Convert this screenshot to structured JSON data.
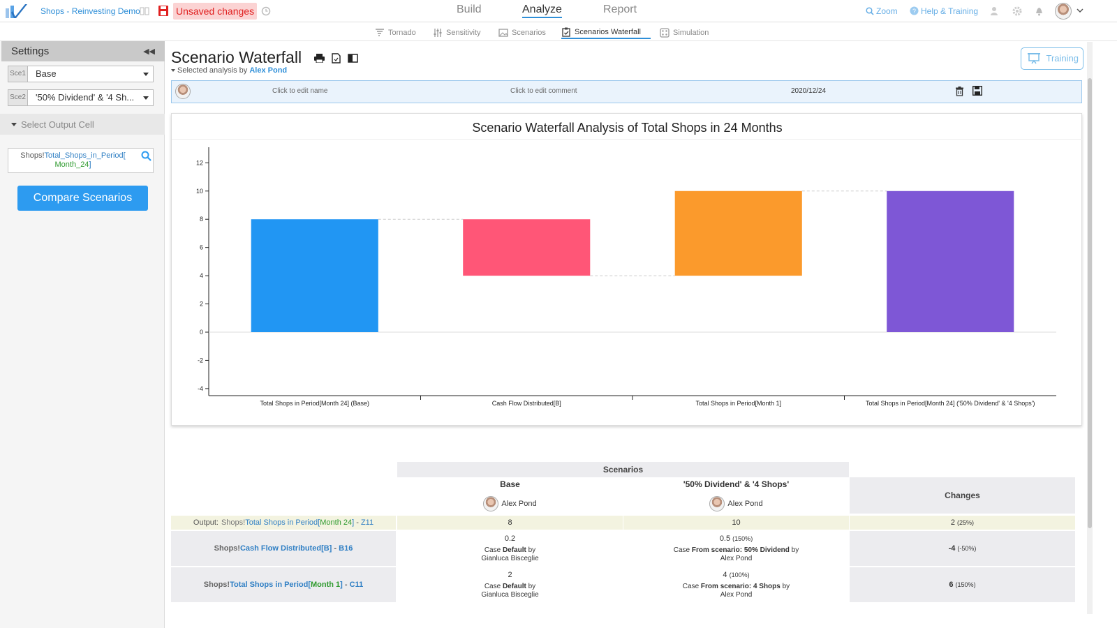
{
  "app": {
    "doc_title": "Shops - Reinvesting Demo",
    "unsaved": "Unsaved changes"
  },
  "topnav": {
    "build": "Build",
    "analyze": "Analyze",
    "report": "Report",
    "zoom": "Zoom",
    "help": "Help & Training"
  },
  "subnav": [
    {
      "label": "Tornado",
      "icon": "tornado-icon"
    },
    {
      "label": "Sensitivity",
      "icon": "sliders-icon"
    },
    {
      "label": "Scenarios",
      "icon": "image-icon"
    },
    {
      "label": "Scenarios Waterfall",
      "icon": "clipboard-check-icon",
      "active": true
    },
    {
      "label": "Simulation",
      "icon": "dice-icon"
    }
  ],
  "sidebar": {
    "title": "Settings",
    "sce1_tag": "Sce1",
    "sce1_value": "Base",
    "sce2_tag": "Sce2",
    "sce2_value": "'50% Dividend' & '4 Sh...",
    "select_output_label": "Select Output Cell",
    "cell_sheet": "Shops!",
    "cell_name": "Total_Shops_in_Period[",
    "cell_index": "Month_24",
    "cell_close": "]",
    "compare_button": "Compare Scenarios"
  },
  "main": {
    "title": "Scenario Waterfall",
    "selected_prefix": "Selected analysis by",
    "selected_user": "Alex Pond",
    "training_button": "Training",
    "analysis_name": "Click to edit name",
    "analysis_comment": "Click to edit comment",
    "analysis_date": "2020/12/24"
  },
  "colors": {
    "accent": "#2d9bf0",
    "bar_base": "#2196f3",
    "bar_negative": "#ff5677",
    "bar_positive": "#fb9a2c",
    "bar_total": "#7e57d6"
  },
  "chart_data": {
    "type": "bar",
    "subtype": "waterfall",
    "title": "Scenario Waterfall Analysis of Total Shops in 24 Months",
    "categories": [
      "Total Shops in Period[Month 24] (Base)",
      "Cash Flow Distributed[B]",
      "Total Shops in Period[Month 1]",
      "Total Shops in Period[Month 24] ('50% Dividend' & '4 Shops')"
    ],
    "ranges": [
      [
        0,
        8
      ],
      [
        4,
        8
      ],
      [
        4,
        10
      ],
      [
        0,
        10
      ]
    ],
    "kinds": [
      "base",
      "negative",
      "positive",
      "total"
    ],
    "ylim": [
      -4.5,
      13.5
    ],
    "yticks": [
      -4,
      -2,
      0,
      2,
      4,
      6,
      8,
      10,
      12
    ],
    "grid": false,
    "legend": "none"
  },
  "table": {
    "scenarios_header": "Scenarios",
    "col_base": "Base",
    "col_alt": "'50% Dividend' & '4 Shops'",
    "col_changes": "Changes",
    "base_user": "Alex Pond",
    "alt_user": "Alex Pond",
    "output_label": "Output:",
    "output_sheet": "Shops!",
    "output_name": "Total Shops in Period[",
    "output_index": "Month 24",
    "output_close": "]",
    "output_sep": " - ",
    "output_cell": "Z11",
    "output_base": "8",
    "output_alt": "10",
    "output_change": "2",
    "output_change_pct": "(25%)",
    "row1_sheet": "Shops!",
    "row1_name": "Cash Flow Distributed",
    "row1_index": "[B]",
    "row1_sep": " - ",
    "row1_cell": "B16",
    "row1_base_value": "0.2",
    "row1_base_case_prefix": "Case ",
    "row1_base_case": "Default",
    "row1_base_by": " by",
    "row1_base_user": "Gianluca Bisceglie",
    "row1_alt_value": "0.5",
    "row1_alt_pct": "(150%)",
    "row1_alt_case_prefix": "Case ",
    "row1_alt_case": "From scenario: 50% Dividend",
    "row1_alt_by": " by",
    "row1_alt_user": "Alex Pond",
    "row1_change": "-4",
    "row1_change_pct": "(-50%)",
    "row2_sheet": "Shops!",
    "row2_name": "Total Shops in Period",
    "row2_index_open": "[",
    "row2_index": "Month 1",
    "row2_index_close": "]",
    "row2_sep": " - ",
    "row2_cell": "C11",
    "row2_base_value": "2",
    "row2_base_case_prefix": "Case ",
    "row2_base_case": "Default",
    "row2_base_by": " by",
    "row2_base_user": "Gianluca Bisceglie",
    "row2_alt_value": "4",
    "row2_alt_pct": "(100%)",
    "row2_alt_case_prefix": "Case ",
    "row2_alt_case": "From scenario: 4 Shops",
    "row2_alt_by": " by",
    "row2_alt_user": "Alex Pond",
    "row2_change": "6",
    "row2_change_pct": "(150%)"
  }
}
